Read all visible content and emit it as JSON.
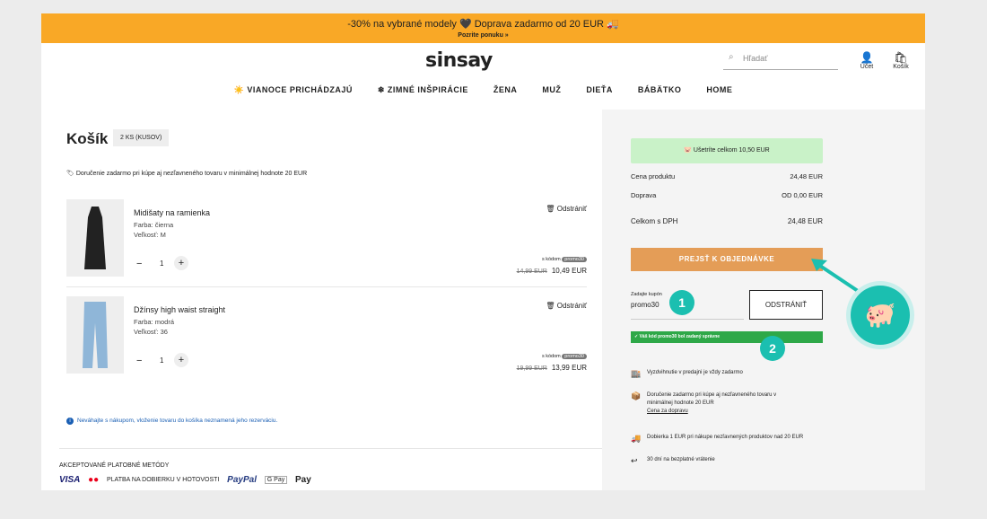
{
  "promo": {
    "line1": "-30% na vybrané modely 🖤 Doprava zadarmo od 20 EUR 🚚",
    "line2": "Pozrite ponuku »"
  },
  "header": {
    "logo": "sinsay",
    "search_placeholder": "Hľadať",
    "account": "Účet",
    "cart": "Košík"
  },
  "nav": [
    "☀️ VIANOCE PRICHÁDZAJÚ",
    "❄ ZIMNÉ INŠPIRÁCIE",
    "ŽENA",
    "MUŽ",
    "DIEŤA",
    "BÁBÄTKO",
    "HOME"
  ],
  "cart": {
    "title": "Košík",
    "count": "2 KS (KUSOV)",
    "delivery_note": "Doručenie zadarmo pri kúpe aj nezľavneného tovaru v minimálnej hodnote 20 EUR",
    "items": [
      {
        "name": "Midišaty na ramienka",
        "color": "Farba: čierna",
        "size": "Veľkosť: M",
        "qty": "1",
        "remove": "Odstrániť",
        "code_label": "s kódom",
        "code": "promo30",
        "old_price": "14,99 EUR",
        "new_price": "10,49 EUR"
      },
      {
        "name": "Džínsy high waist straight",
        "color": "Farba: modrá",
        "size": "Veľkosť: 36",
        "qty": "1",
        "remove": "Odstrániť",
        "code_label": "s kódom",
        "code": "promo30",
        "old_price": "19,99 EUR",
        "new_price": "13,99 EUR"
      }
    ],
    "info": "Neváhajte s nákupom, vloženie tovaru do košíka neznamená jeho rezerváciu."
  },
  "payment": {
    "heading": "AKCEPTOVANÉ PLATOBNÉ METÓDY",
    "methods": [
      "VISA",
      "●●",
      "PLATBA NA DOBIERKU V HOTOVOSTI",
      "PayPal",
      "G Pay",
      "Pay"
    ]
  },
  "summary": {
    "saving": "Ušetríte celkom 10,50 EUR",
    "rows": [
      {
        "label": "Cena produktu",
        "value": "24,48 EUR"
      },
      {
        "label": "Doprava",
        "value": "OD 0,00 EUR"
      },
      {
        "label": "Celkom s DPH",
        "value": "24,48 EUR"
      }
    ],
    "cta": "PREJSŤ K OBJEDNÁVKE",
    "coupon_label": "Zadajte kupón",
    "coupon_value": "promo30",
    "remove_btn": "ODSTRÁNIŤ",
    "success": "✓ Váš kód promo30 bol zadaný správne",
    "steps": [
      "1",
      "2"
    ],
    "benefits": [
      {
        "icon": "store-icon",
        "text": "Vyzdvihnutie v predajni je vždy zadarmo"
      },
      {
        "icon": "box-icon",
        "text": "Doručenie zadarmo pri kúpe aj nezľavneného tovaru v minimálnej hodnote 20 EUR",
        "link": "Cena za dopravu"
      },
      {
        "icon": "truck-icon",
        "text": "Dobierka 1 EUR pri nákupe nezľavnených produktov nad 20 EUR"
      },
      {
        "icon": "return-icon",
        "text": "30 dní na bezplatné vrátenie"
      }
    ]
  },
  "colors": {
    "promo": "#f9a826",
    "cta": "#e49d57",
    "accent": "#1bbfb0",
    "success": "#2ea848"
  }
}
